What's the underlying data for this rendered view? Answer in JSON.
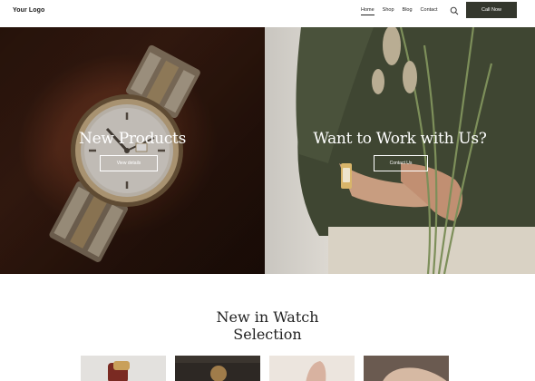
{
  "header": {
    "logo": "Your Logo",
    "nav": [
      {
        "label": "Home",
        "active": true
      },
      {
        "label": "Shop",
        "active": false
      },
      {
        "label": "Blog",
        "active": false
      },
      {
        "label": "Contact",
        "active": false
      }
    ],
    "search_icon": "search-icon",
    "cta": "Call Now"
  },
  "hero": {
    "left": {
      "title": "New Products",
      "button": "View details"
    },
    "right": {
      "title": "Want to Work with Us?",
      "button": "Contact Us"
    }
  },
  "section": {
    "title_line1": "New in Watch",
    "title_line2": "Selection"
  },
  "colors": {
    "accent": "#34372d",
    "text": "#1a1a1a",
    "background": "#ffffff"
  }
}
